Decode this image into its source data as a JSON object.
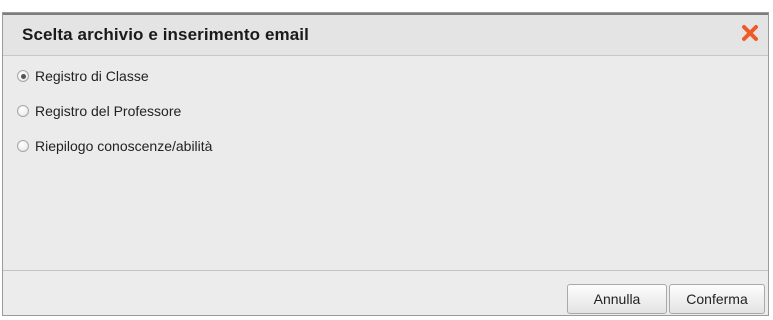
{
  "dialog": {
    "title": "Scelta archivio e inserimento email",
    "close_icon": "close-x-icon",
    "close_color": "#f05a28"
  },
  "options": [
    {
      "label": "Registro di Classe",
      "checked": true
    },
    {
      "label": "Registro del Professore",
      "checked": false
    },
    {
      "label": "Riepilogo conoscenze/abilità",
      "checked": false
    }
  ],
  "footer": {
    "cancel_label": "Annulla",
    "confirm_label": "Conferma"
  }
}
